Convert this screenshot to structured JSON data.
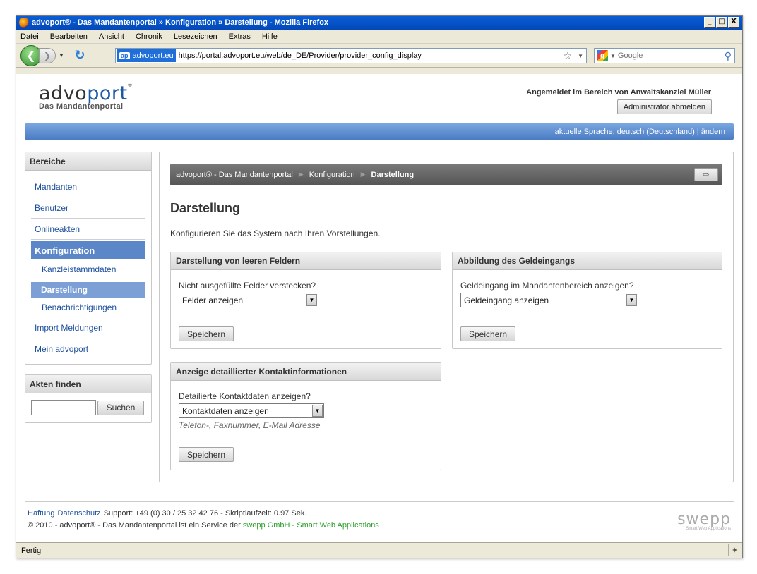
{
  "window": {
    "title": "advoport® - Das Mandantenportal  »  Konfiguration  »  Darstellung - Mozilla Firefox",
    "controls": [
      "_",
      "□",
      "X"
    ]
  },
  "menu": [
    "Datei",
    "Bearbeiten",
    "Ansicht",
    "Chronik",
    "Lesezeichen",
    "Extras",
    "Hilfe"
  ],
  "toolbar": {
    "back_icon": "back-arrow-icon",
    "forward_icon": "forward-arrow-icon",
    "reload_icon": "reload-icon",
    "site_badge": "ap",
    "site_name": "advoport.eu",
    "url": "https://portal.advoport.eu/web/de_DE/Provider/provider_config_display",
    "search_placeholder": "Google"
  },
  "header": {
    "logo_word_a": "advo",
    "logo_word_b": "port",
    "logo_mark": "®",
    "tagline": "Das Mandantenportal",
    "login_info": "Angemeldet im Bereich von Anwaltskanzlei Müller",
    "logout_label": "Administrator abmelden",
    "language": "aktuelle Sprache: deutsch (Deutschland) | ändern"
  },
  "sidebar": {
    "title": "Bereiche",
    "items": [
      {
        "label": "Mandanten"
      },
      {
        "label": "Benutzer"
      },
      {
        "label": "Onlineakten"
      },
      {
        "label": "Konfiguration"
      },
      {
        "label": "Kanzleistammdaten"
      },
      {
        "label": "Darstellung"
      },
      {
        "label": "Benachrichtigungen"
      },
      {
        "label": "Import Meldungen"
      },
      {
        "label": "Mein advoport"
      }
    ],
    "search_title": "Akten finden",
    "search_value": "",
    "search_button": "Suchen"
  },
  "breadcrumb": [
    "advoport® - Das Mandantenportal",
    "Konfiguration",
    "Darstellung"
  ],
  "main": {
    "title": "Darstellung",
    "intro": "Konfigurieren Sie das System nach Ihren Vorstellungen.",
    "boxes": [
      {
        "title": "Darstellung von leeren Feldern",
        "label": "Nicht ausgefüllte Felder verstecken?",
        "selected": "Felder anzeigen",
        "hint": "",
        "button": "Speichern"
      },
      {
        "title": "Abbildung des Geldeingangs",
        "label": "Geldeingang im Mandantenbereich anzeigen?",
        "selected": "Geldeingang anzeigen",
        "hint": "",
        "button": "Speichern"
      },
      {
        "title": "Anzeige detaillierter Kontaktinformationen",
        "label": "Detailierte Kontaktdaten anzeigen?",
        "selected": "Kontaktdaten anzeigen",
        "hint": "Telefon-, Faxnummer, E-Mail Adresse",
        "button": "Speichern"
      }
    ]
  },
  "footer": {
    "link_haftung": "Haftung",
    "link_datenschutz": "Datenschutz",
    "support": "Support: +49 (0) 30 / 25 32 42 76 - Skriptlaufzeit: 0.97 Sek.",
    "copyright": "© 2010 - advoport® - Das Mandantenportal ist ein Service der",
    "service_link": "swepp GmbH - Smart Web Applications",
    "brand": "swepp",
    "brand_sub": "Smart Web Applications"
  },
  "status": {
    "text": "Fertig"
  }
}
